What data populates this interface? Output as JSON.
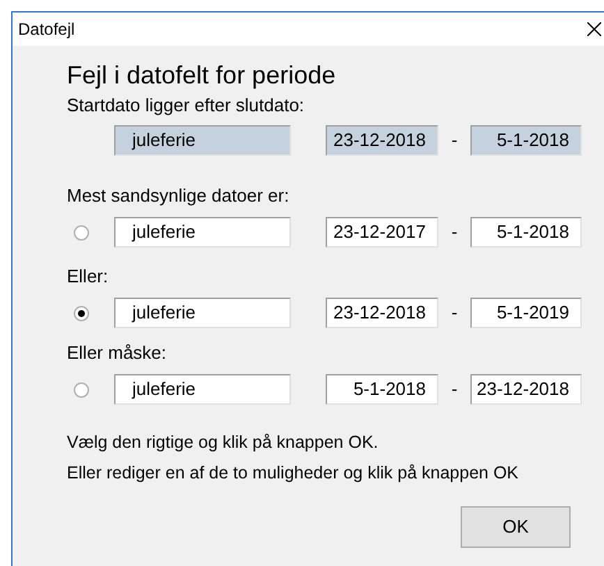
{
  "window": {
    "title": "Datofejl"
  },
  "heading": "Fejl i datofelt for periode",
  "error_label": "Startdato ligger efter slutdato:",
  "error_row": {
    "name": "juleferie",
    "start": "23-12-2018",
    "separator": "-",
    "end": "5-1-2018",
    "disabled": true
  },
  "options": [
    {
      "label": "Mest sandsynlige datoer er:",
      "selected": false,
      "name": "juleferie",
      "start": "23-12-2017",
      "separator": "-",
      "end": "5-1-2018"
    },
    {
      "label": "Eller:",
      "selected": true,
      "name": "juleferie",
      "start": "23-12-2018",
      "separator": "-",
      "end": "5-1-2019"
    },
    {
      "label": "Eller måske:",
      "selected": false,
      "name": "juleferie",
      "start": "5-1-2018",
      "separator": "-",
      "end": "23-12-2018"
    }
  ],
  "instructions": [
    "Vælg den rigtige og klik på knappen OK.",
    "Eller rediger en af de to muligheder og klik på knappen OK"
  ],
  "buttons": [
    "OK"
  ]
}
